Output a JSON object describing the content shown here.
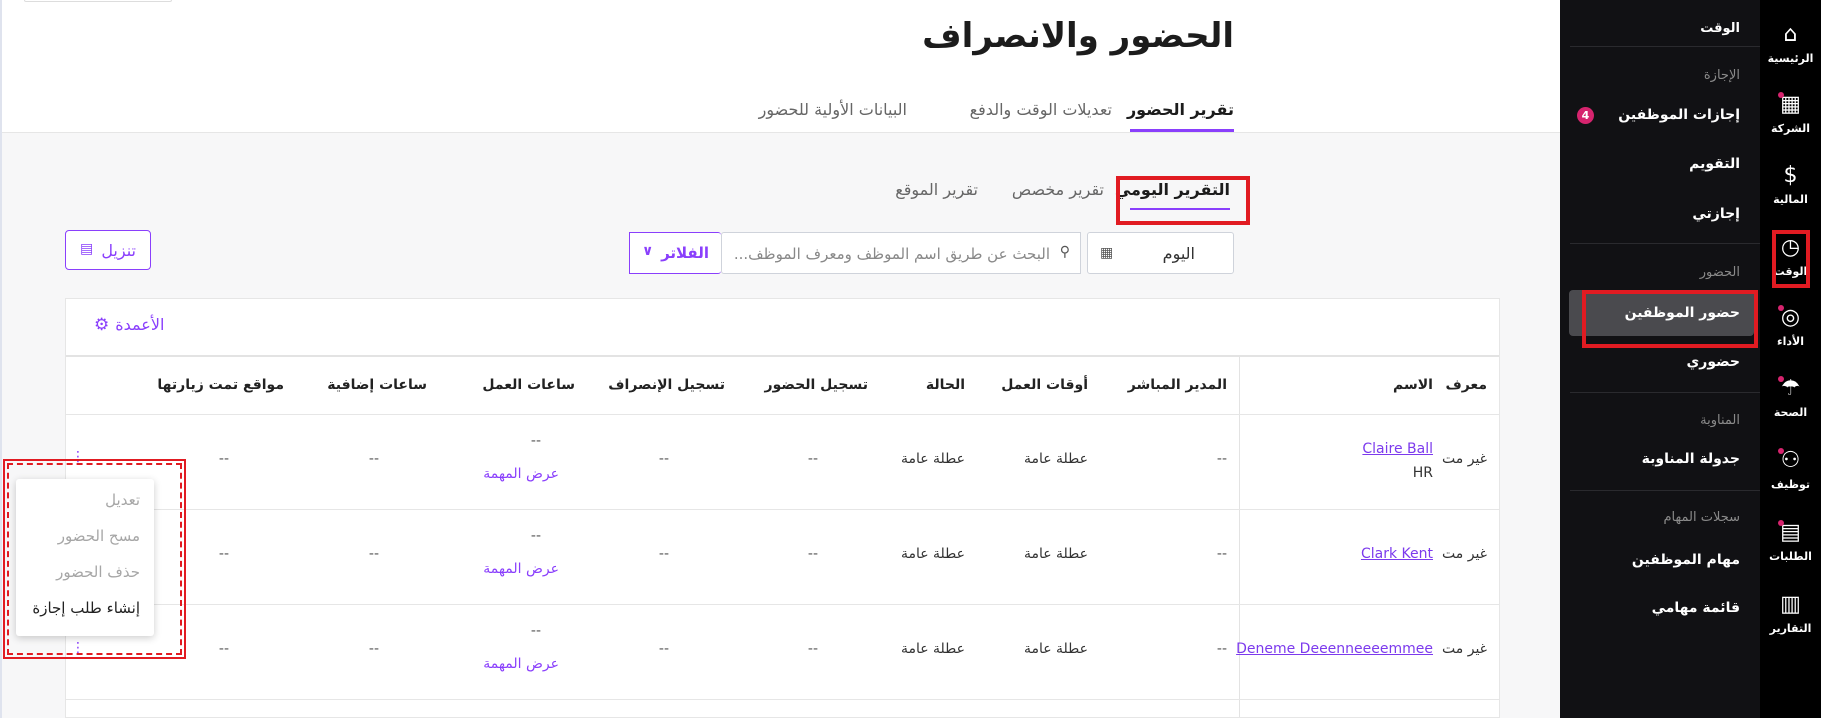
{
  "page": {
    "title": "الحضور والانصراف"
  },
  "tabs": [
    "تقرير الحضور",
    "تعديلات الوقت والدفع",
    "البيانات الأولية للحضور"
  ],
  "subtabs": [
    "التقرير اليومي",
    "تقرير مخصص",
    "تقرير الموقع"
  ],
  "filters": {
    "date_value": "اليوم",
    "search_placeholder": "البحث عن طريق اسم الموظف ومعرف الموظف...",
    "filter_label": "الفلاتر",
    "download_label": "تنزيل"
  },
  "table": {
    "columns_button": "الأعمدة",
    "headers": [
      "معرف",
      "الاسم",
      "المدير المباشر",
      "أوقات العمل",
      "الحالة",
      "تسجيل الحضور",
      "تسجيل الإنصراف",
      "ساعات العمل",
      "ساعات إضافية",
      "مواقع تمت زيارتها"
    ],
    "rows": [
      {
        "id": "غير مت",
        "name": "Claire Ball",
        "dept": "HR",
        "manager": "--",
        "work_times": "عطلة عامة",
        "status": "عطلة عامة",
        "check_in": "--",
        "check_out": "--",
        "hours": "--",
        "task_link": "عرض المهمة",
        "overtime": "--",
        "locations": "--"
      },
      {
        "id": "غير مت",
        "name": "Clark Kent",
        "dept": "",
        "manager": "--",
        "work_times": "عطلة عامة",
        "status": "عطلة عامة",
        "check_in": "--",
        "check_out": "--",
        "hours": "--",
        "task_link": "عرض المهمة",
        "overtime": "--",
        "locations": "--"
      },
      {
        "id": "غير مت",
        "name": "Deneme Deeenneeeemmee",
        "dept": "",
        "manager": "--",
        "work_times": "عطلة عامة",
        "status": "عطلة عامة",
        "check_in": "--",
        "check_out": "--",
        "hours": "--",
        "task_link": "عرض المهمة",
        "overtime": "--",
        "locations": "--"
      }
    ]
  },
  "context_menu": {
    "items": [
      {
        "label": "تعديل",
        "enabled": false
      },
      {
        "label": "مسح الحضور",
        "enabled": false
      },
      {
        "label": "حذف الحضور",
        "enabled": false
      },
      {
        "label": "إنشاء طلب إجازة",
        "enabled": true
      }
    ]
  },
  "sidebar": {
    "header": "الوقت",
    "sections": {
      "leave": "الإجازة",
      "attendance": "الحضور",
      "shift": "المناوبة",
      "tasks": "سجلات المهام"
    },
    "items": {
      "employee_leaves": "إجازات الموظفين",
      "employee_leaves_badge": "4",
      "calendar": "التقويم",
      "my_leave": "إجازتي",
      "employee_attendance": "حضور الموظفين",
      "my_attendance": "حضوري",
      "shift_schedule": "جدولة المناوبة",
      "employee_tasks": "مهام الموظفين",
      "my_tasks": "قائمة مهامي"
    }
  },
  "rail": {
    "items": [
      {
        "label": "الرئيسية",
        "icon": "home-icon"
      },
      {
        "label": "الشركة",
        "icon": "building-icon"
      },
      {
        "label": "المالية",
        "icon": "dollar-icon"
      },
      {
        "label": "الوقت",
        "icon": "clock-icon"
      },
      {
        "label": "الأداء",
        "icon": "target-icon"
      },
      {
        "label": "الصحة",
        "icon": "umbrella-icon"
      },
      {
        "label": "توظيف",
        "icon": "people-icon"
      },
      {
        "label": "الطلبات",
        "icon": "clipboard-icon"
      },
      {
        "label": "التقارير",
        "icon": "chart-icon"
      }
    ]
  },
  "colors": {
    "accent": "#8a3ffc",
    "highlight": "#e11b22",
    "badge": "#d6246e"
  }
}
